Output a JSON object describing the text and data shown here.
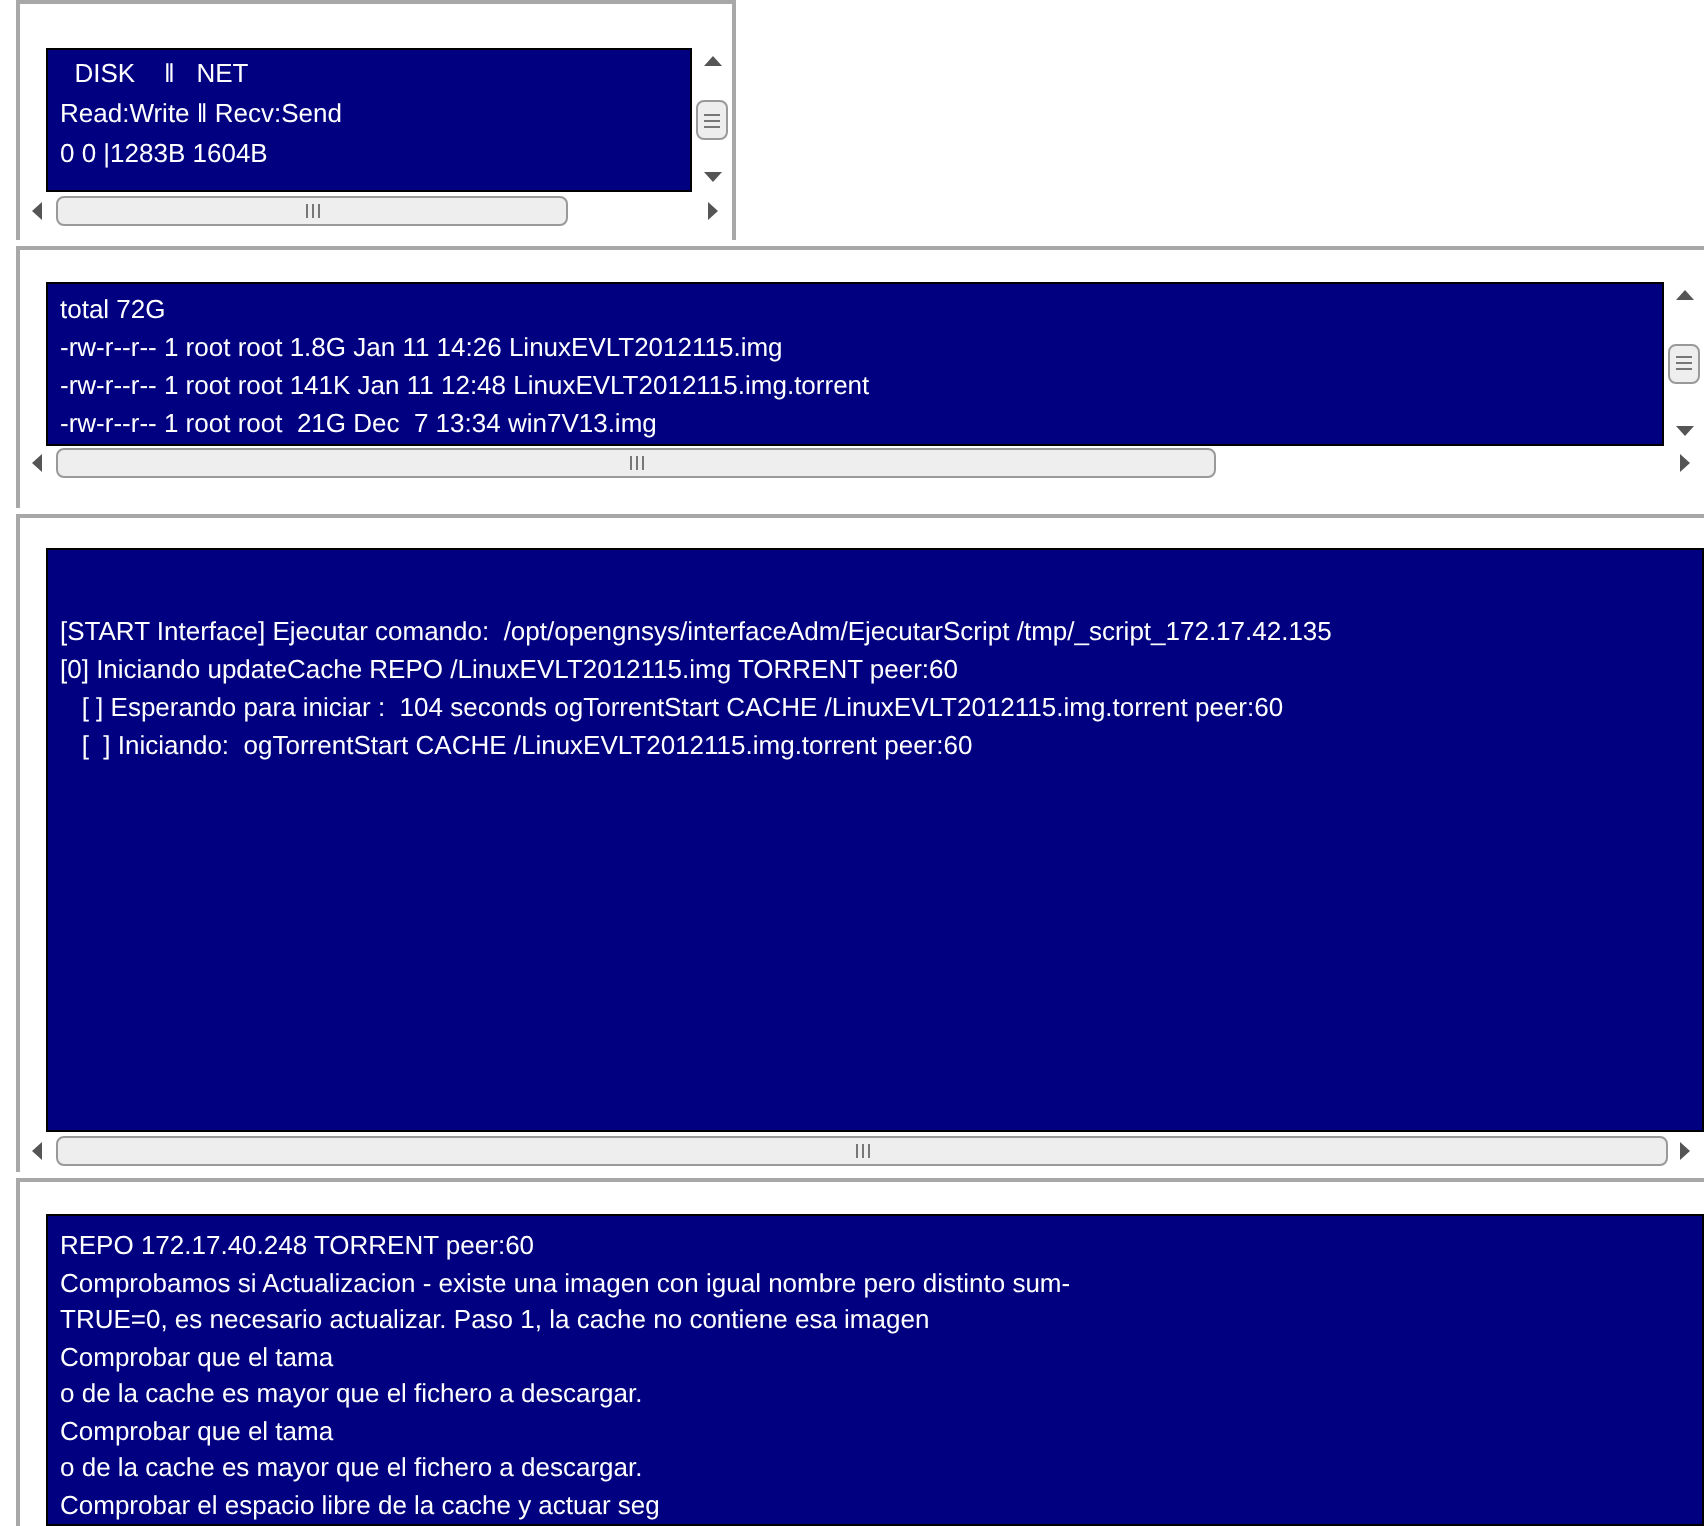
{
  "panels": [
    {
      "lines": [
        "  DISK    ‖   NET",
        "Read:Write ‖ Recv:Send",
        "0 0 |1283B 1604B"
      ]
    },
    {
      "lines": [
        "total 72G",
        "-rw-r--r-- 1 root root 1.8G Jan 11 14:26 LinuxEVLT2012115.img",
        "-rw-r--r-- 1 root root 141K Jan 11 12:48 LinuxEVLT2012115.img.torrent",
        "-rw-r--r-- 1 root root  21G Dec  7 13:34 win7V13.img"
      ]
    },
    {
      "lines": [
        "[START Interface] Ejecutar comando:  /opt/opengnsys/interfaceAdm/EjecutarScript /tmp/_script_172.17.42.135",
        "[0] Iniciando updateCache REPO /LinuxEVLT2012115.img TORRENT peer:60",
        "   [ ] Esperando para iniciar :  104 seconds ogTorrentStart CACHE /LinuxEVLT2012115.img.torrent peer:60",
        "   [  ] Iniciando:  ogTorrentStart CACHE /LinuxEVLT2012115.img.torrent peer:60"
      ]
    },
    {
      "lines": [
        "REPO 172.17.40.248 TORRENT peer:60",
        "Comprobamos si Actualizacion - existe una imagen con igual nombre pero distinto sum-",
        "TRUE=0, es necesario actualizar. Paso 1, la cache no contiene esa imagen",
        "Comprobar que el tama",
        "o de la cache es mayor que el fichero a descargar.",
        "Comprobar que el tama",
        "o de la cache es mayor que el fichero a descargar.",
        "Comprobar el espacio libre de la cache y actuar seg"
      ]
    }
  ]
}
